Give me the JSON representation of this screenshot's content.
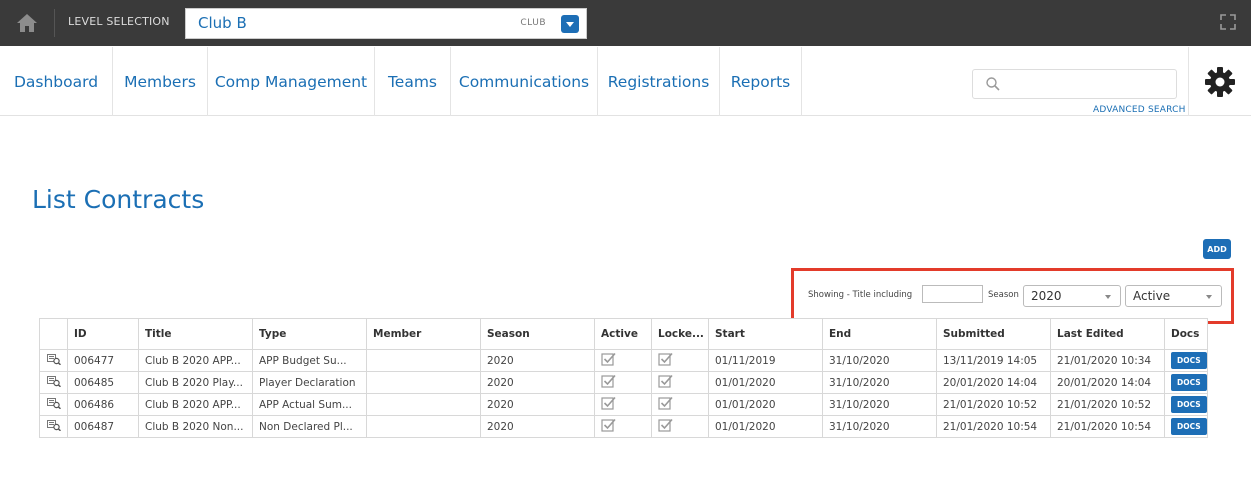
{
  "topbar": {
    "level_label": "LEVEL SELECTION",
    "club_name": "Club B",
    "club_type": "CLUB"
  },
  "nav": {
    "items": [
      "Dashboard",
      "Members",
      "Comp Management",
      "Teams",
      "Communications",
      "Registrations",
      "Reports"
    ],
    "search_placeholder": "",
    "advanced_search": "ADVANCED SEARCH"
  },
  "page": {
    "title": "List Contracts",
    "add_label": "ADD"
  },
  "filters": {
    "title_label": "Showing - Title including",
    "title_value": "",
    "season_label": "Season",
    "season_value": "2020",
    "status_value": "Active"
  },
  "table": {
    "columns": [
      "",
      "ID",
      "Title",
      "Type",
      "Member",
      "Season",
      "Active",
      "Locke...",
      "Start",
      "End",
      "Submitted",
      "Last Edited",
      "Docs"
    ],
    "rows": [
      {
        "id": "006477",
        "title": "Club B 2020 APP...",
        "type": "APP Budget Su...",
        "member": "",
        "season": "2020",
        "start": "01/11/2019",
        "end": "31/10/2020",
        "submitted": "13/11/2019 14:05",
        "last_edited": "21/01/2020 10:34",
        "docs": "DOCS"
      },
      {
        "id": "006485",
        "title": "Club B 2020 Play...",
        "type": "Player Declaration",
        "member": "",
        "season": "2020",
        "start": "01/01/2020",
        "end": "31/10/2020",
        "submitted": "20/01/2020 14:04",
        "last_edited": "20/01/2020 14:04",
        "docs": "DOCS"
      },
      {
        "id": "006486",
        "title": "Club B 2020 APP...",
        "type": "APP Actual Sum...",
        "member": "",
        "season": "2020",
        "start": "01/01/2020",
        "end": "31/10/2020",
        "submitted": "21/01/2020 10:52",
        "last_edited": "21/01/2020 10:52",
        "docs": "DOCS"
      },
      {
        "id": "006487",
        "title": "Club B 2020 Non...",
        "type": "Non Declared Pl...",
        "member": "",
        "season": "2020",
        "start": "01/01/2020",
        "end": "31/10/2020",
        "submitted": "21/01/2020 10:54",
        "last_edited": "21/01/2020 10:54",
        "docs": "DOCS"
      }
    ]
  },
  "colors": {
    "brand_blue": "#1b6fb4",
    "button_blue": "#1d6eb6",
    "topbar": "#3a3a3a",
    "highlight_red": "#e33b2a"
  },
  "icons": [
    "home-icon",
    "dropdown-icon",
    "expand-icon",
    "search-icon",
    "gear-icon",
    "view-record-icon",
    "checkbox-checked-icon"
  ]
}
